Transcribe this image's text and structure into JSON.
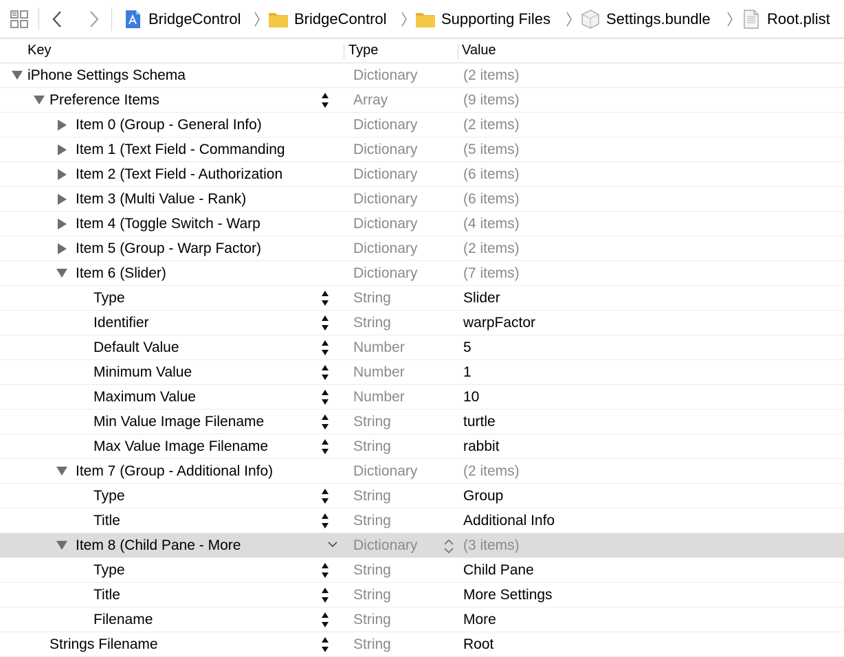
{
  "breadcrumb": {
    "items": [
      {
        "label": "BridgeControl",
        "icon": "project-icon"
      },
      {
        "label": "BridgeControl",
        "icon": "folder-icon"
      },
      {
        "label": "Supporting Files",
        "icon": "folder-icon"
      },
      {
        "label": "Settings.bundle",
        "icon": "bundle-icon"
      },
      {
        "label": "Root.plist",
        "icon": "plist-file-icon"
      }
    ]
  },
  "columns": {
    "key": "Key",
    "type": "Type",
    "value": "Value"
  },
  "colors": {
    "selected_row": "#dcdcdc",
    "folder": "#f5c842",
    "muted_text": "#8a8a8a"
  },
  "rows": [
    {
      "key": "iPhone Settings Schema",
      "type": "Dictionary",
      "value": "(2 items)"
    },
    {
      "key": "Preference Items",
      "type": "Array",
      "value": "(9 items)"
    },
    {
      "key": "Item 0 (Group - General Info)",
      "type": "Dictionary",
      "value": "(2 items)"
    },
    {
      "key": "Item 1 (Text Field - Commanding",
      "type": "Dictionary",
      "value": "(5 items)"
    },
    {
      "key": "Item 2 (Text Field - Authorization",
      "type": "Dictionary",
      "value": "(6 items)"
    },
    {
      "key": "Item 3 (Multi Value - Rank)",
      "type": "Dictionary",
      "value": "(6 items)"
    },
    {
      "key": "Item 4 (Toggle Switch - Warp",
      "type": "Dictionary",
      "value": "(4 items)"
    },
    {
      "key": "Item 5 (Group - Warp Factor)",
      "type": "Dictionary",
      "value": "(2 items)"
    },
    {
      "key": "Item 6 (Slider)",
      "type": "Dictionary",
      "value": "(7 items)"
    },
    {
      "key": "Type",
      "type": "String",
      "value": "Slider"
    },
    {
      "key": "Identifier",
      "type": "String",
      "value": "warpFactor"
    },
    {
      "key": "Default Value",
      "type": "Number",
      "value": "5"
    },
    {
      "key": "Minimum Value",
      "type": "Number",
      "value": "1"
    },
    {
      "key": "Maximum Value",
      "type": "Number",
      "value": "10"
    },
    {
      "key": "Min Value Image Filename",
      "type": "String",
      "value": "turtle"
    },
    {
      "key": "Max Value Image Filename",
      "type": "String",
      "value": "rabbit"
    },
    {
      "key": "Item 7 (Group - Additional Info)",
      "type": "Dictionary",
      "value": "(2 items)"
    },
    {
      "key": "Type",
      "type": "String",
      "value": "Group"
    },
    {
      "key": "Title",
      "type": "String",
      "value": "Additional Info"
    },
    {
      "key": "Item 8 (Child Pane - More",
      "type": "Dictionary",
      "value": "(3 items)"
    },
    {
      "key": "Type",
      "type": "String",
      "value": "Child Pane"
    },
    {
      "key": "Title",
      "type": "String",
      "value": "More Settings"
    },
    {
      "key": "Filename",
      "type": "String",
      "value": "More"
    },
    {
      "key": "Strings Filename",
      "type": "String",
      "value": "Root"
    }
  ]
}
